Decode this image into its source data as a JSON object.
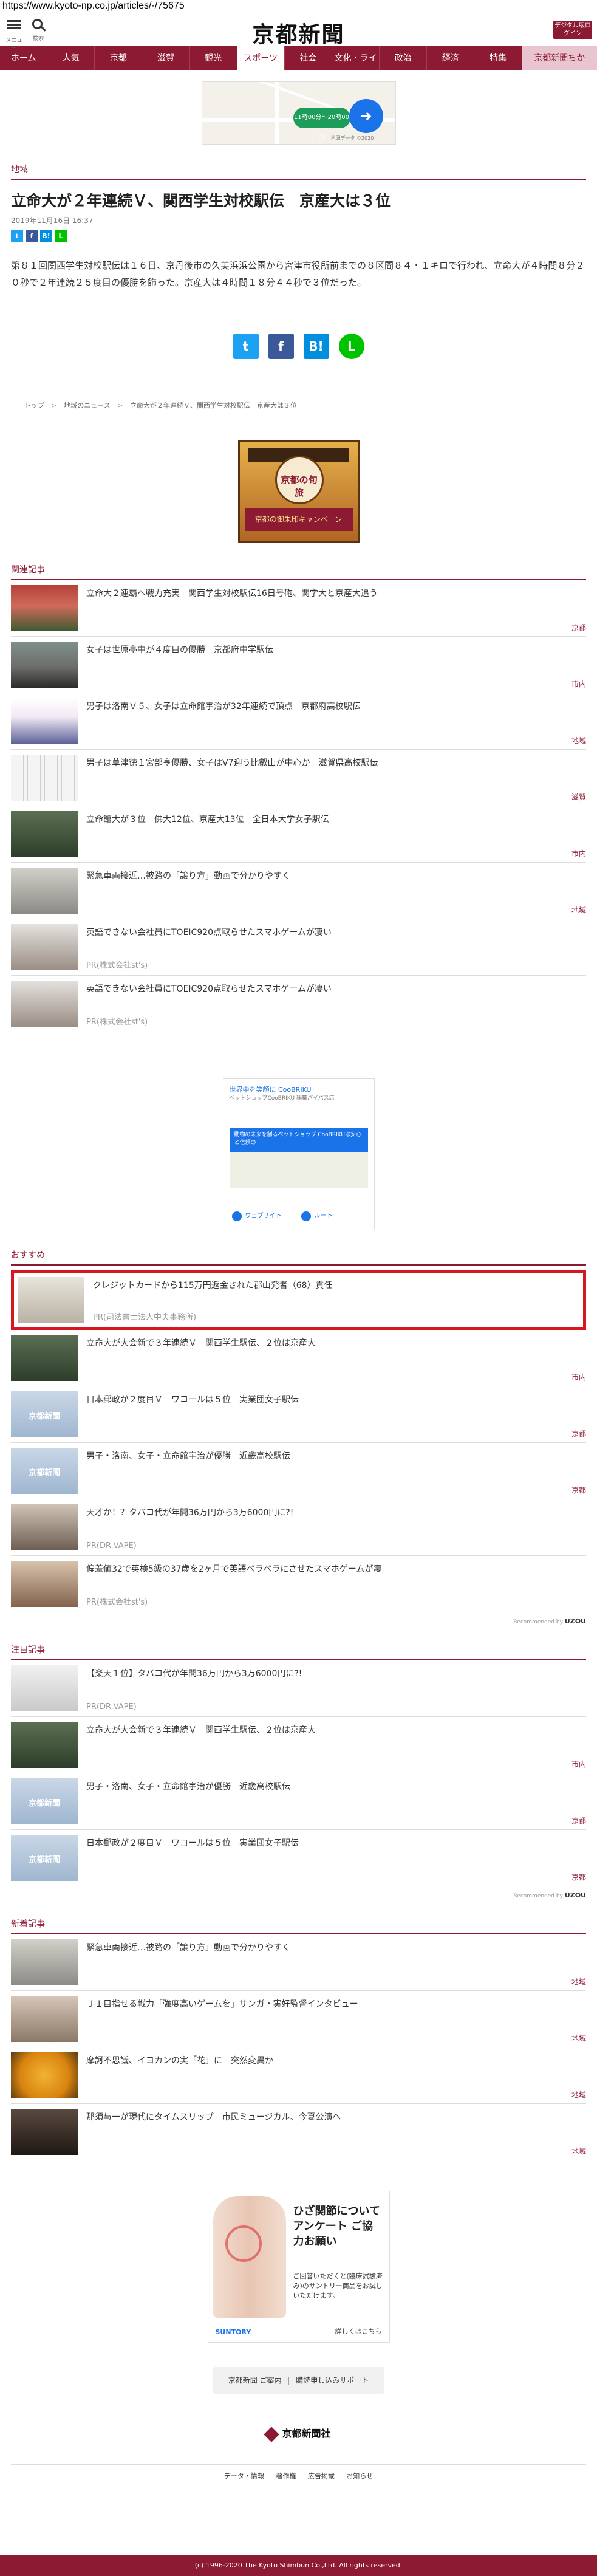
{
  "browser": {
    "url": "https://www.kyoto-np.co.jp/articles/-/75675"
  },
  "header": {
    "menu_label": "メニュー",
    "search_label": "検索",
    "logo": "京都新聞",
    "digital_button": "デジタル版ログイン"
  },
  "nav": {
    "items": [
      "ホーム",
      "人気",
      "京都",
      "滋賀",
      "観光",
      "スポーツ",
      "社会",
      "文化・ライフ",
      "政治",
      "経済",
      "特集"
    ],
    "active": "スポーツ",
    "last": "京都新聞ちか"
  },
  "ad_top": {
    "pill": "11時00分〜20時00分",
    "note": "地図データ ©2020"
  },
  "article": {
    "category": "地域",
    "title": "立命大が２年連続Ｖ、関西学生対校駅伝　京産大は３位",
    "date": "2019年11月16日 16:37",
    "body": "第８１回関西学生対校駅伝は１６日、京丹後市の久美浜浜公園から宮津市役所前までの８区間８４・１キロで行われ、立命大が４時間８分２０秒で２年連続２５度目の優勝を飾った。京産大は４時間１８分４４秒で３位だった。",
    "share_small": [
      "t",
      "f",
      "B!",
      "L"
    ],
    "share_big": [
      "t",
      "f",
      "B!",
      "L"
    ]
  },
  "breadcrumb": [
    "トップ",
    "地域のニュース",
    "立命大が２年連続Ｖ、関西学生対校駅伝　京産大は３位"
  ],
  "ad_shrine": {
    "title": "京都の旬旅",
    "band": "京都の御朱印キャンペーン"
  },
  "related": {
    "heading": "関連記事",
    "items": [
      {
        "title": "立命大２連覇へ戦力充実　関西学生対校駅伝16日号砲、関学大と京産大追う",
        "cat": "京都"
      },
      {
        "title": "女子は世原亭中が４度目の優勝　京都府中学駅伝",
        "cat": "市内"
      },
      {
        "title": "男子は洛南Ｖ５、女子は立命館宇治が32年連続で頂点　京都府高校駅伝",
        "cat": "地域"
      },
      {
        "title": "男子は草津徳１宮部亨優勝、女子はV7迎う比叡山が中心か　滋賀県高校駅伝",
        "cat": "滋賀"
      },
      {
        "title": "立命館大が３位　佛大12位、京産大13位　全日本大学女子駅伝",
        "cat": "市内"
      },
      {
        "title": "緊急車両接近…被路の「譲り方」動画で分かりやすく",
        "cat": "地域"
      },
      {
        "title": "英語できない会社員にTOEIC920点取らせたスマホゲームが凄い",
        "pr": "PR(株式会社st's)"
      },
      {
        "title": "英語できない会社員にTOEIC920点取らせたスマホゲームが凄い",
        "pr": "PR(株式会社st's)"
      }
    ]
  },
  "ad_mid": {
    "title": "世界中を笑顔に CooBRIKU",
    "sub": "ペットショップCooBRIKU 稲築パイパス店",
    "blue": "動物の未来を創るペットショップ CooBRIKUは安心と信頼の",
    "btn1": "ウェブサイト",
    "btn2": "ルート"
  },
  "recommend": {
    "heading": "おすすめ",
    "items": [
      {
        "title": "クレジットカードから115万円返金された郡山発者（68）貢任",
        "pr": "PR(司法書士法人中央事務所)"
      },
      {
        "title": "立命大が大会新で３年連続Ｖ　関西学生駅伝、２位は京産大",
        "cat": "市内"
      },
      {
        "title": "日本郵政が２度目Ｖ　ワコールは５位　実業団女子駅伝",
        "cat": "京都"
      },
      {
        "title": "男子・洛南、女子・立命館宇治が優勝　近畿高校駅伝",
        "cat": "京都"
      },
      {
        "title": "天才か！？タバコ代が年間36万円から3万6000円に?!",
        "pr": "PR(DR.VAPE)"
      },
      {
        "title": "偏差値32で英検5級の37歳を2ヶ月で英語ペラペラにさせたスマホゲームが凄",
        "pr": "PR(株式会社st's)"
      }
    ],
    "powered": "Recommended by",
    "brand": "UZOU"
  },
  "featured": {
    "heading": "注目記事",
    "items": [
      {
        "title": "【楽天１位】タバコ代が年間36万円から3万6000円に?!",
        "pr": "PR(DR.VAPE)"
      },
      {
        "title": "立命大が大会新で３年連続Ｖ　関西学生駅伝、２位は京産大",
        "cat": "市内"
      },
      {
        "title": "男子・洛南、女子・立命館宇治が優勝　近畿高校駅伝",
        "cat": "京都"
      },
      {
        "title": "日本郵政が２度目Ｖ　ワコールは５位　実業団女子駅伝",
        "cat": "京都"
      }
    ],
    "powered": "Recommended by",
    "brand": "UZOU"
  },
  "news_label": "京都新聞",
  "latest": {
    "heading": "新着記事",
    "items": [
      {
        "title": "緊急車両接近…被路の「譲り方」動画で分かりやすく",
        "cat": "地域"
      },
      {
        "title": "Ｊ１目指せる戦力「強度高いゲームを」サンガ・実好監督インタビュー",
        "cat": "地域"
      },
      {
        "title": "摩訶不思議、イヨカンの実「花」に　突然変異か",
        "cat": "地域"
      },
      {
        "title": "那須与一が現代にタイムスリップ　市民ミュージカル、今夏公演へ",
        "cat": "地域"
      }
    ]
  },
  "ad_knee": {
    "headline": "ひざ関節について アンケート ご協力お願い",
    "small": "ご回答いただくと(臨床試験済み)のサントリー商品をお試しいただけます。",
    "brand": "SUNTORY",
    "more": "詳しくはこちら"
  },
  "footer": {
    "links": [
      "京都新聞 ご案内",
      "購読申し込みサポート"
    ],
    "logo": "京都新聞社",
    "menu": [
      "データ・情報",
      "著作権",
      "広告掲載",
      "お知らせ"
    ],
    "copyright": "(c) 1996-2020 The Kyoto Shimbun Co.,Ltd. All rights reserved."
  }
}
